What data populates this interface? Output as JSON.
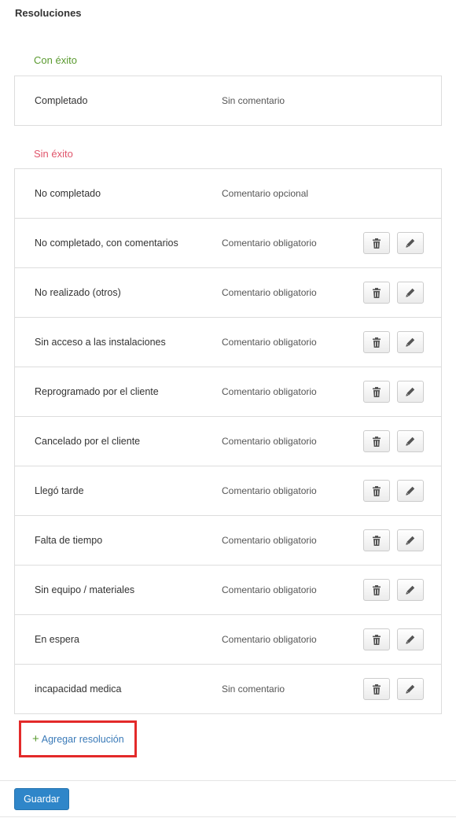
{
  "page": {
    "title": "Resoluciones"
  },
  "success_section": {
    "heading": "Con éxito",
    "rows": [
      {
        "name": "Completado",
        "comment": "Sin comentario"
      }
    ]
  },
  "fail_section": {
    "heading": "Sin éxito",
    "rows": [
      {
        "name": "No completado",
        "comment": "Comentario opcional",
        "actions": false
      },
      {
        "name": "No completado, con comentarios",
        "comment": "Comentario obligatorio",
        "actions": true
      },
      {
        "name": "No realizado (otros)",
        "comment": "Comentario obligatorio",
        "actions": true
      },
      {
        "name": "Sin acceso a las instalaciones",
        "comment": "Comentario obligatorio",
        "actions": true
      },
      {
        "name": "Reprogramado por el cliente",
        "comment": "Comentario obligatorio",
        "actions": true
      },
      {
        "name": "Cancelado por el cliente",
        "comment": "Comentario obligatorio",
        "actions": true
      },
      {
        "name": "Llegó tarde",
        "comment": "Comentario obligatorio",
        "actions": true
      },
      {
        "name": "Falta de tiempo",
        "comment": "Comentario obligatorio",
        "actions": true
      },
      {
        "name": "Sin equipo / materiales",
        "comment": "Comentario obligatorio",
        "actions": true
      },
      {
        "name": "En espera",
        "comment": "Comentario obligatorio",
        "actions": true
      },
      {
        "name": "incapacidad medica",
        "comment": "Sin comentario",
        "actions": true
      }
    ]
  },
  "add_resolution": {
    "icon": "plus-icon",
    "plus": "+",
    "label": "Agregar resolución"
  },
  "footer": {
    "save_label": "Guardar"
  },
  "icons": {
    "delete": "trash-icon",
    "edit": "pencil-icon"
  },
  "colors": {
    "success_heading": "#5a9a2f",
    "fail_heading": "#e0556b",
    "link": "#3a7ab8",
    "primary_button": "#2f86c9",
    "highlight_box": "#e32a2a"
  }
}
